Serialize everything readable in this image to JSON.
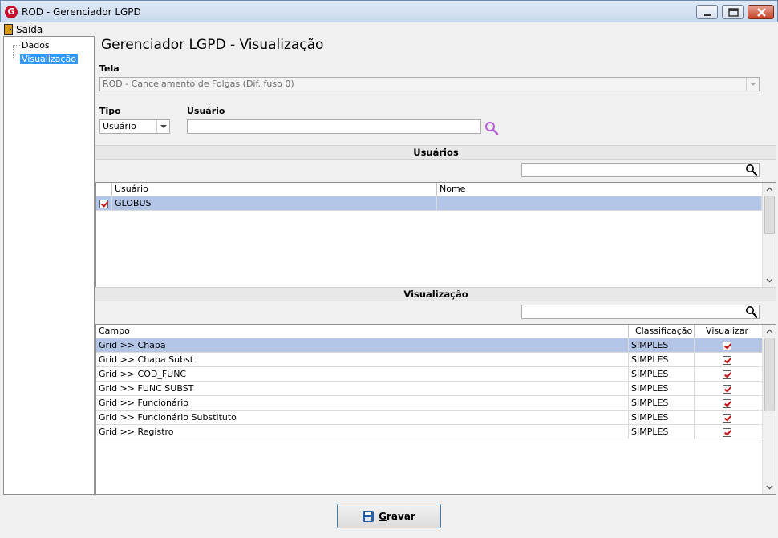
{
  "window": {
    "title": "ROD - Gerenciador LGPD",
    "logo_letter": "G"
  },
  "menu": {
    "exit_label": "Saída"
  },
  "tree": {
    "items": [
      {
        "label": "Dados"
      },
      {
        "label": "Visualização"
      }
    ]
  },
  "page": {
    "title": "Gerenciador LGPD - Visualização"
  },
  "form": {
    "screen_label": "Tela",
    "screen_value": "ROD - Cancelamento de Folgas (Dif. fuso 0)",
    "type_label": "Tipo",
    "type_value": "Usuário",
    "user_label": "Usuário",
    "user_value": ""
  },
  "users_section": {
    "header": "Usuários",
    "search_value": "",
    "columns": [
      "Usuário",
      "Nome"
    ],
    "rows": [
      {
        "user": "GLOBUS",
        "name": "",
        "checked": true
      }
    ]
  },
  "view_section": {
    "header": "Visualização",
    "search_value": "",
    "columns": [
      "Campo",
      "Classificação",
      "Visualizar"
    ],
    "rows": [
      {
        "field": "Grid >> Chapa",
        "classification": "SIMPLES",
        "visible": true
      },
      {
        "field": "Grid >> Chapa Subst",
        "classification": "SIMPLES",
        "visible": true
      },
      {
        "field": "Grid >> COD_FUNC",
        "classification": "SIMPLES",
        "visible": true
      },
      {
        "field": "Grid >> FUNC SUBST",
        "classification": "SIMPLES",
        "visible": true
      },
      {
        "field": "Grid >> Funcionário",
        "classification": "SIMPLES",
        "visible": true
      },
      {
        "field": "Grid >> Funcionário Substituto",
        "classification": "SIMPLES",
        "visible": true
      },
      {
        "field": "Grid >> Registro",
        "classification": "SIMPLES",
        "visible": true
      }
    ]
  },
  "actions": {
    "save_first": "G",
    "save_rest": "ravar"
  },
  "colors": {
    "selection": "#b3c6e8",
    "tree_selection": "#3399ff",
    "check": "#c81414",
    "button_border": "#3c7fb1"
  },
  "icons": [
    "app-logo-icon",
    "door-icon",
    "minimize-icon",
    "maximize-icon",
    "close-icon",
    "search-icon",
    "floppy-disk-icon"
  ]
}
